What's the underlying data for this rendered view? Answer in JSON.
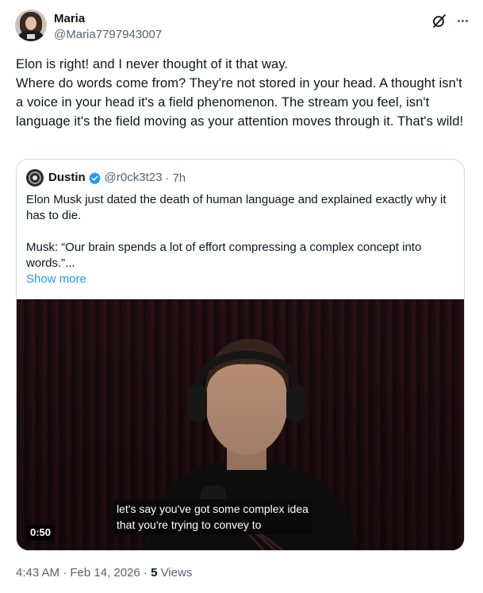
{
  "author": {
    "name": "Maria",
    "handle": "@Maria7797943007"
  },
  "tweet": {
    "text": "Elon is right! and I never thought of it that way.\nWhere do words come from? They're not stored in your head. A thought isn't a voice in your head it's a field phenomenon. The stream you feel, isn't language it's the field moving as your attention moves through it. That's wild!"
  },
  "quote": {
    "name": "Dustin",
    "handle": "@r0ck3t23",
    "separator": "·",
    "time": "7h",
    "text": "Elon Musk just dated the death of human language and explained exactly why it has to die.\n\nMusk: “Our brain spends a lot of effort compressing a complex concept into words.”...",
    "show_more": "Show more",
    "video": {
      "duration": "0:50",
      "subtitle": "let's say you've got some complex idea\nthat you're trying to convey to"
    }
  },
  "meta": {
    "timestamp": "4:43 AM · Feb 14, 2026 · ",
    "views_count": "5",
    "views_label": " Views"
  },
  "colors": {
    "accent": "#1d9bf0",
    "secondary_text": "#536471",
    "border": "#cfd9de"
  },
  "icons": [
    "grok-icon",
    "more-icon",
    "verified-icon"
  ]
}
